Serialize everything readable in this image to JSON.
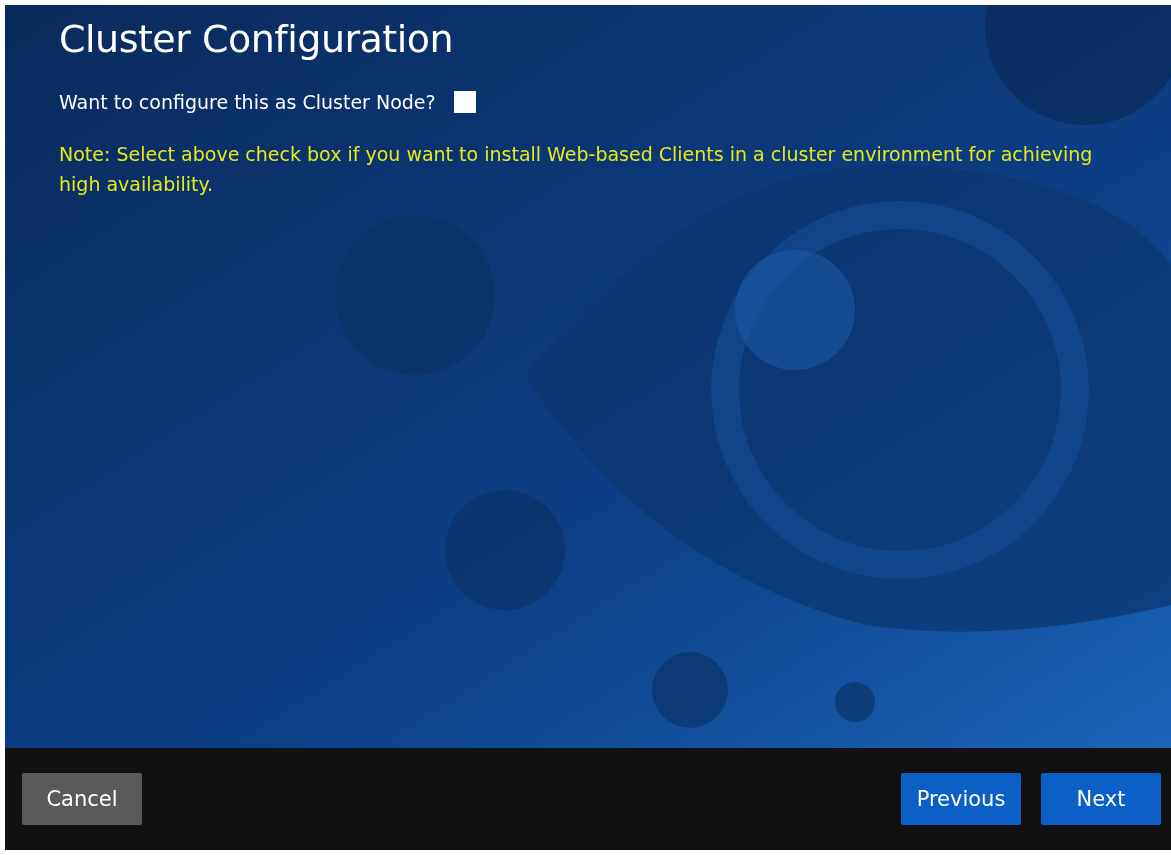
{
  "page": {
    "title": "Cluster Configuration"
  },
  "cluster_node": {
    "label": "Want to configure this as Cluster Node?",
    "checked": false
  },
  "note": "Note: Select above check box if you want to install Web-based Clients in a cluster environment for achieving high availability.",
  "buttons": [
    {
      "label": "Cancel",
      "kind": "secondary"
    },
    {
      "label": "Previous",
      "kind": "primary"
    },
    {
      "label": "Next",
      "kind": "primary"
    }
  ]
}
